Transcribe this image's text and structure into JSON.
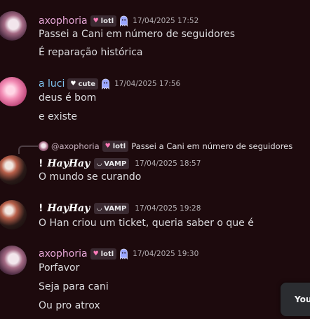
{
  "messages": [
    {
      "author": "axophoria",
      "badge": "lotl",
      "timestamp": "17/04/2025 17:52",
      "lines": [
        "Passei a Cani em número de seguidores",
        "É reparação histórica"
      ]
    },
    {
      "author": "a luci",
      "badge": "cute",
      "timestamp": "17/04/2025 17:56",
      "lines": [
        "deus é bom",
        "e existe"
      ]
    },
    {
      "reply": {
        "author": "@axophoria",
        "badge": "lotl",
        "text": "Passei a Cani em número de seguidores"
      },
      "prefix": "!",
      "author": "HayHay",
      "badge": "VAMP",
      "timestamp": "17/04/2025 18:57",
      "lines": [
        "O mundo se curando"
      ]
    },
    {
      "prefix": "!",
      "author": "HayHay",
      "badge": "VAMP",
      "timestamp": "17/04/2025 19:28",
      "lines": [
        "O Han criou um ticket, queria saber o que é"
      ]
    },
    {
      "author": "axophoria",
      "badge": "lotl",
      "timestamp": "17/04/2025 19:30",
      "lines": [
        "Porfavor",
        "Seja para cani",
        "Ou pro atrox"
      ]
    }
  ],
  "popup": {
    "text": "You"
  },
  "colors": {
    "background": "#1d0a0d",
    "name_axophoria": "#e6a6d6",
    "name_luci": "#7fc4f0",
    "name_hayhay": "#ffffff"
  },
  "icons": {
    "lotl_badge": "heart-icon",
    "cute_badge": "heart-icon",
    "vamp_badge": "fangs-icon",
    "decoration": "ghost-icon"
  }
}
